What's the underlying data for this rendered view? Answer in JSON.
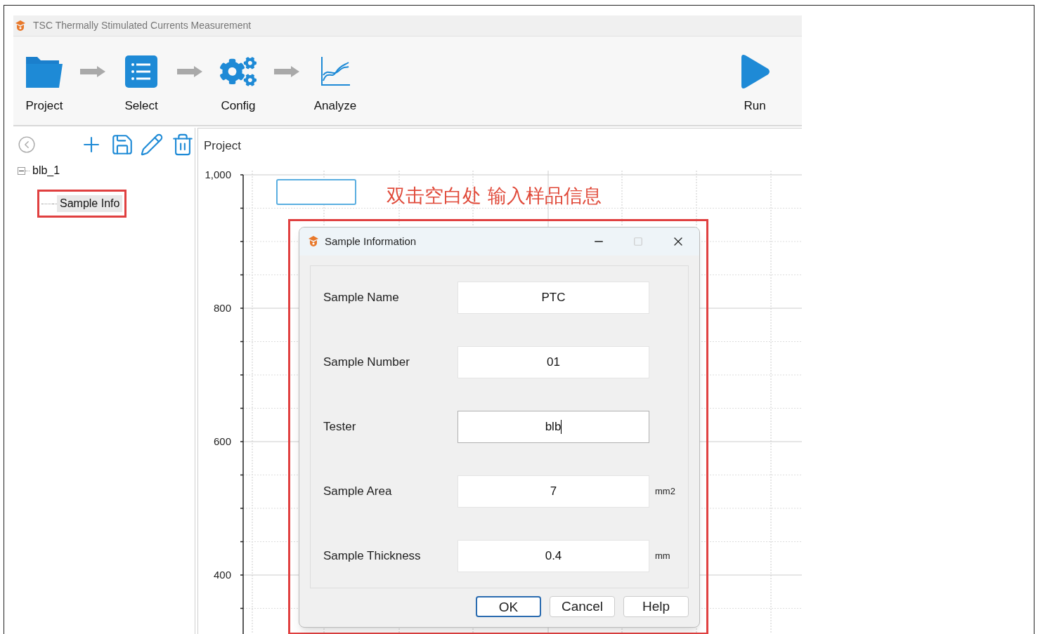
{
  "window": {
    "title": "TSC Thermally Stimulated Currents Measurement"
  },
  "toolbar": [
    {
      "label": "Project",
      "kind": "folder"
    },
    {
      "label": "Select",
      "kind": "list"
    },
    {
      "label": "Config",
      "kind": "gears"
    },
    {
      "label": "Analyze",
      "kind": "chart"
    }
  ],
  "run_button": {
    "label": "Run"
  },
  "tree": [
    {
      "label": "blb_1",
      "expanded": true,
      "selected": false,
      "children": [
        {
          "label": "Sample Info",
          "selected": true
        }
      ]
    }
  ],
  "panel": {
    "title": "Project"
  },
  "chart": {
    "y_ticks": [
      "1,000",
      "800",
      "600",
      "400"
    ]
  },
  "annotation": {
    "text": "双击空白处 输入样品信息"
  },
  "dialog": {
    "title": "Sample Information",
    "fields": [
      {
        "label": "Sample Name",
        "value": "PTC",
        "focused": false
      },
      {
        "label": "Sample Number",
        "value": "01",
        "focused": false
      },
      {
        "label": "Tester",
        "value": "blb",
        "focused": true
      },
      {
        "label": "Sample Area",
        "value": "7",
        "unit": "mm2",
        "focused": false
      },
      {
        "label": "Sample Thickness",
        "value": "0.4",
        "unit": "mm",
        "focused": false
      }
    ],
    "buttons": [
      {
        "label": "OK",
        "default": true
      },
      {
        "label": "Cancel",
        "default": false
      },
      {
        "label": "Help",
        "default": false
      }
    ]
  }
}
